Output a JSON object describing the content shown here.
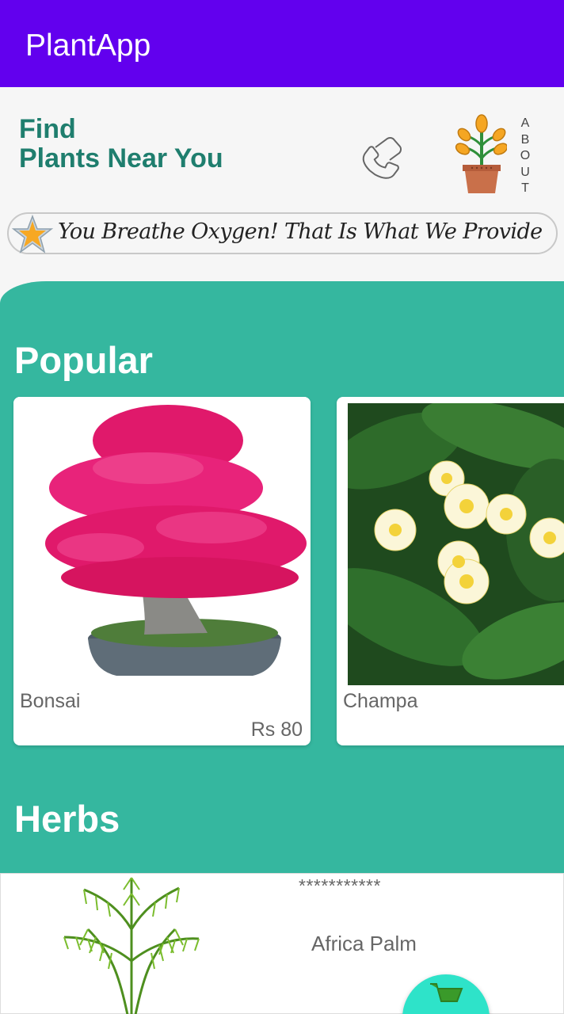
{
  "app": {
    "title": "PlantApp"
  },
  "header": {
    "headline_line1": "Find",
    "headline_line2": "Plants Near You",
    "about_letters": [
      "A",
      "B",
      "O",
      "U",
      "T"
    ]
  },
  "banner": {
    "text": "You Breathe Oxygen! That Is What We Provide"
  },
  "popular": {
    "title": "Popular",
    "items": [
      {
        "name": "Bonsai",
        "price": "Rs 80"
      },
      {
        "name": "Champa",
        "price": ""
      }
    ]
  },
  "herbs": {
    "title": "Herbs",
    "items": [
      {
        "rating_text": "***********",
        "name": "Africa Palm"
      }
    ]
  },
  "colors": {
    "appbar": "#6200ee",
    "teal": "#35b79f",
    "headline": "#1f7e6e",
    "fab": "#2ee3c9"
  }
}
